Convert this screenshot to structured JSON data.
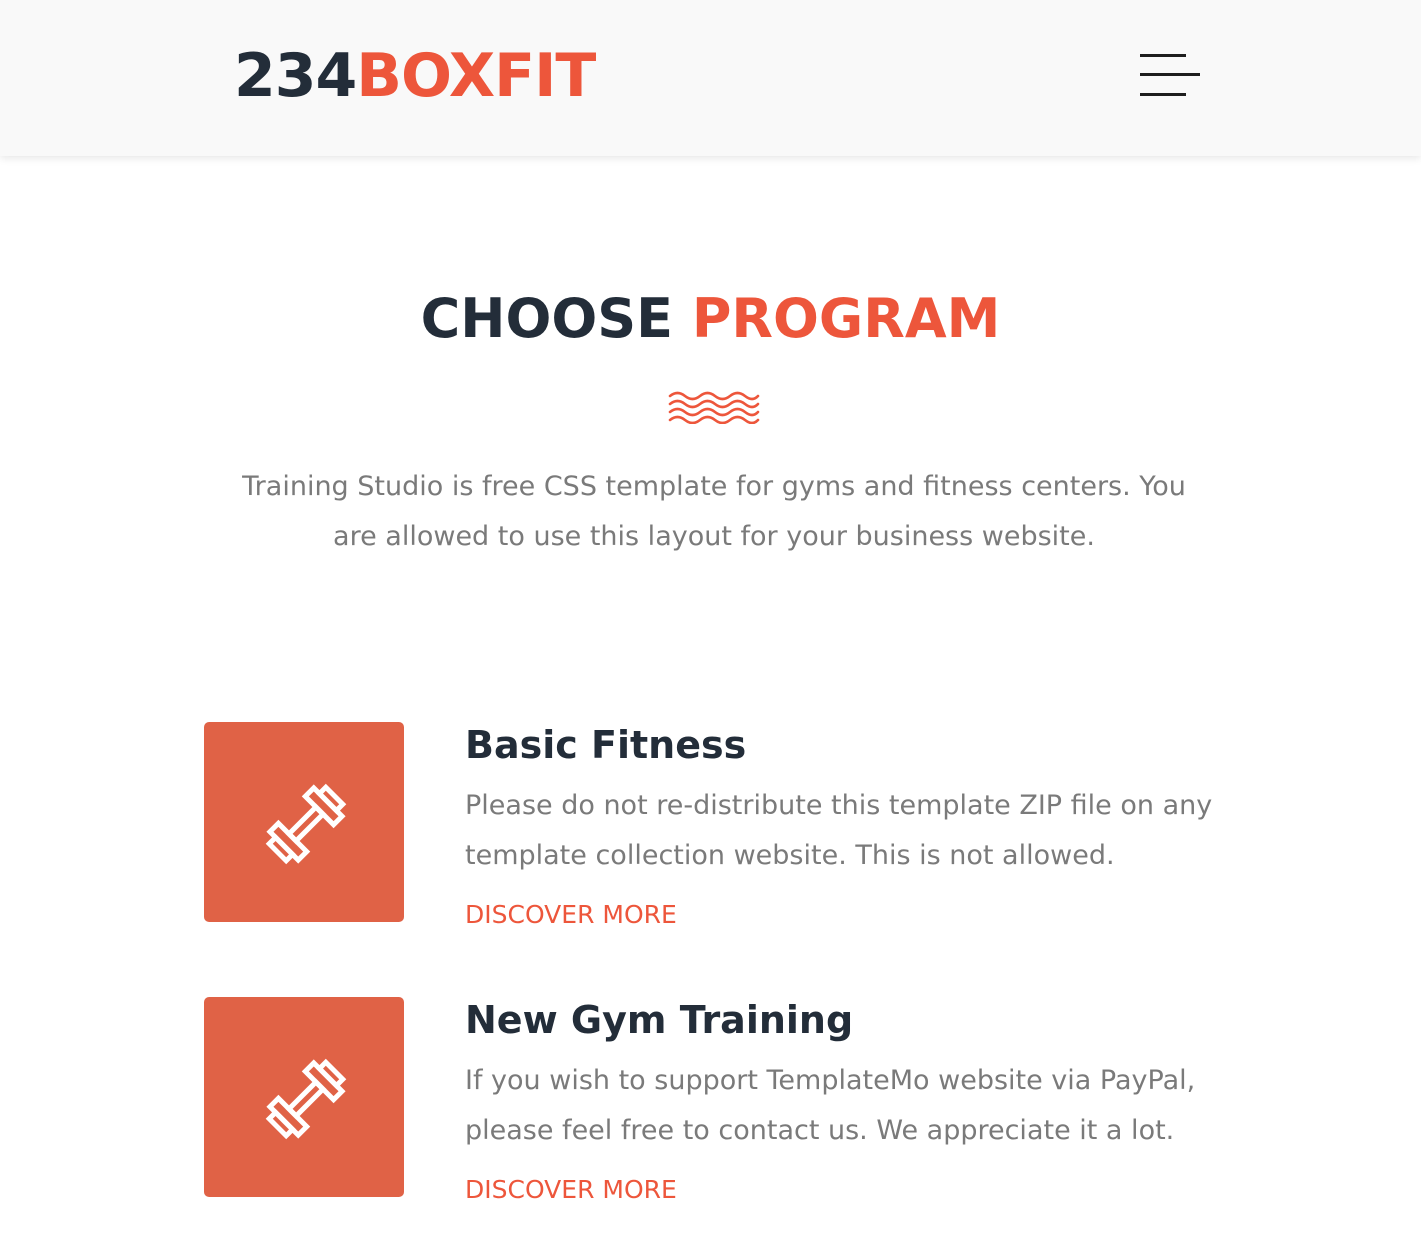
{
  "header": {
    "logo_dark": "234",
    "logo_accent": "BOXFIT",
    "menu_icon": "hamburger-menu-icon"
  },
  "section": {
    "heading_dark": "CHOOSE",
    "heading_accent": "PROGRAM",
    "divider_icon": "wave-divider-icon",
    "intro": "Training Studio is free CSS template for gyms and fitness centers. You are allowed to use this layout for your business website."
  },
  "programs": [
    {
      "icon": "dumbbell-icon",
      "title": "Basic Fitness",
      "description": "Please do not re-distribute this template ZIP file on any template collection website. This is not allowed.",
      "link": "DISCOVER MORE"
    },
    {
      "icon": "dumbbell-icon",
      "title": "New Gym Training",
      "description": "If you wish to support TemplateMo website via PayPal, please feel free to contact us. We appreciate it a lot.",
      "link": "DISCOVER MORE"
    }
  ],
  "colors": {
    "accent": "#ed563b",
    "dark": "#232d39",
    "text_muted": "#7a7a7a",
    "icon_box": "#e06246"
  }
}
